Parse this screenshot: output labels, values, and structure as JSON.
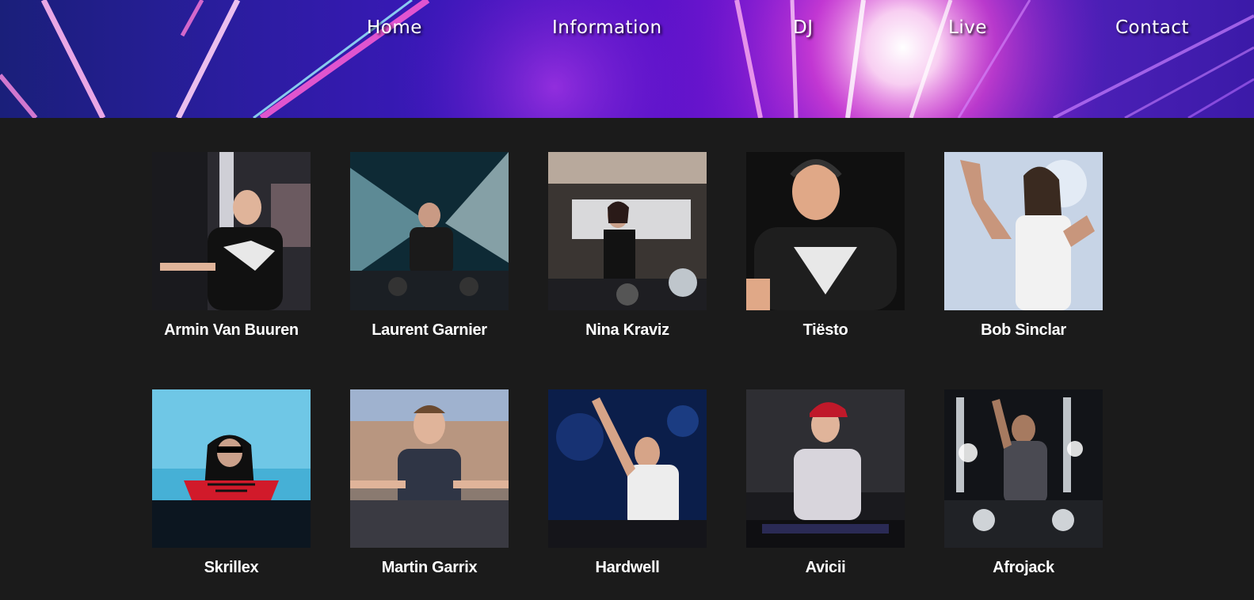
{
  "nav": {
    "items": [
      {
        "label": "Home"
      },
      {
        "label": "Information"
      },
      {
        "label": "DJ"
      },
      {
        "label": "Live"
      },
      {
        "label": "Contact"
      }
    ]
  },
  "gallery": {
    "djs": [
      {
        "name": "Armin Van Buuren"
      },
      {
        "name": "Laurent Garnier"
      },
      {
        "name": "Nina Kraviz"
      },
      {
        "name": "Tiësto"
      },
      {
        "name": "Bob Sinclar"
      },
      {
        "name": "Skrillex"
      },
      {
        "name": "Martin Garrix"
      },
      {
        "name": "Hardwell"
      },
      {
        "name": "Avicii"
      },
      {
        "name": "Afrojack"
      }
    ]
  },
  "colors": {
    "page_background": "#1b1b1b",
    "banner_purple": "#5a12c9",
    "banner_magenta": "#ff3fd2",
    "nav_text": "#ffffff",
    "name_text": "#ffffff"
  }
}
